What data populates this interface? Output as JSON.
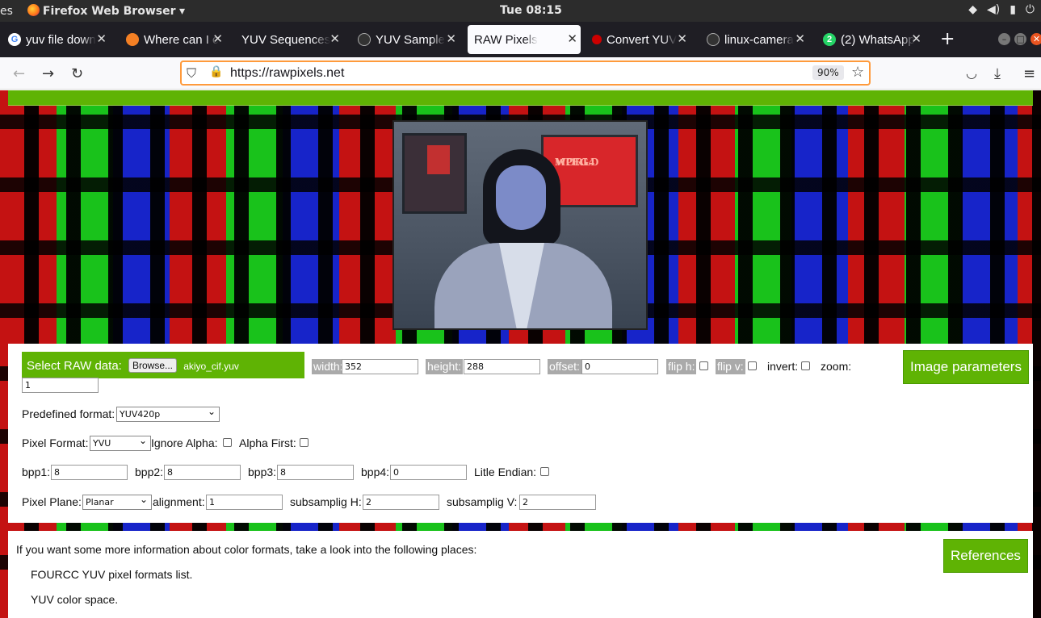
{
  "system": {
    "app_label_prefix": "es",
    "app_name": "Firefox Web Browser",
    "clock": "Tue 08:15"
  },
  "tabs": [
    {
      "label": "yuv file down",
      "icon": "google-icon"
    },
    {
      "label": "Where can I c",
      "icon": "stackoverflow-icon"
    },
    {
      "label": "YUV Sequences",
      "icon": "blank-icon"
    },
    {
      "label": "YUV Sample",
      "icon": "github-icon"
    },
    {
      "label": "RAW Pixels",
      "icon": "none",
      "active": true
    },
    {
      "label": "Convert YUV",
      "icon": "red-icon"
    },
    {
      "label": "linux-camera",
      "icon": "github-icon"
    },
    {
      "label": "(2) WhatsApp",
      "icon": "whatsapp-icon"
    }
  ],
  "navbar": {
    "url": "https://rawpixels.net",
    "zoom": "90%"
  },
  "preview": {
    "mon_text_1": "MPEG4",
    "mon_text_2": "WORLD"
  },
  "form": {
    "select_raw_label": "Select RAW data:",
    "browse_label": "Browse...",
    "file_name": "akiyo_cif.yuv",
    "width_label": "width:",
    "width_value": "352",
    "height_label": "height:",
    "height_value": "288",
    "offset_label": "offset:",
    "offset_value": "0",
    "fliph_label": "flip h:",
    "flipv_label": "flip v:",
    "invert_label": "invert:",
    "zoom_label": "zoom:",
    "zoom_value": "1",
    "image_params_label": "Image parameters",
    "predefined_label": "Predefined format:",
    "predefined_value": "YUV420p",
    "pixel_format_label": "Pixel Format:",
    "pixel_format_value": "YVU",
    "ignore_alpha_label": "Ignore Alpha:",
    "alpha_first_label": "Alpha First:",
    "bpp1_label": "bpp1:",
    "bpp1_value": "8",
    "bpp2_label": "bpp2:",
    "bpp2_value": "8",
    "bpp3_label": "bpp3:",
    "bpp3_value": "8",
    "bpp4_label": "bpp4:",
    "bpp4_value": "0",
    "endian_label": "Litle Endian:",
    "pixel_plane_label": "Pixel Plane:",
    "pixel_plane_value": "Planar",
    "alignment_label": "alignment:",
    "alignment_value": "1",
    "subh_label": "subsamplig H:",
    "subh_value": "2",
    "subv_label": "subsamplig V:",
    "subv_value": "2"
  },
  "info": {
    "intro": "If you want some more information about color formats, take a look into the following places:",
    "link1": "FOURCC YUV pixel formats list.",
    "link2": "YUV color space.",
    "references_label": "References"
  },
  "colors": {
    "accent": "#5fb304",
    "url_focus": "#ff9a3b"
  }
}
